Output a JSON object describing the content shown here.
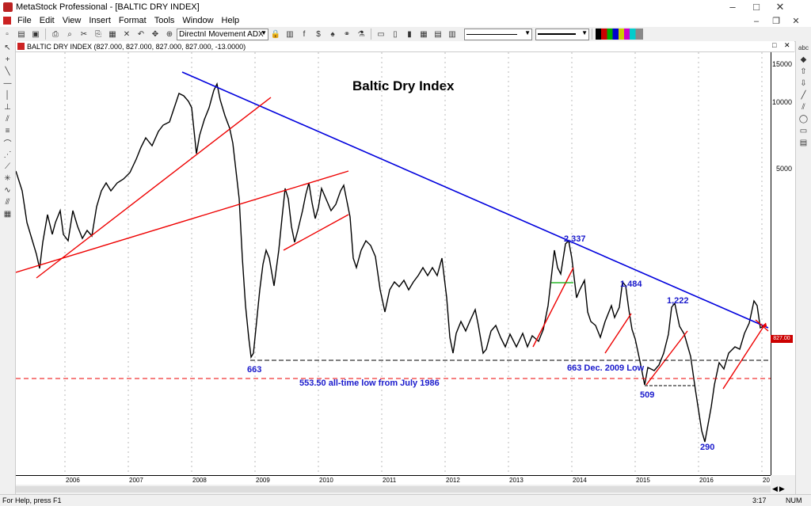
{
  "window": {
    "title": "MetaStock Professional - [BALTIC DRY INDEX]"
  },
  "menu": [
    "File",
    "Edit",
    "View",
    "Insert",
    "Format",
    "Tools",
    "Window",
    "Help"
  ],
  "toolbar": {
    "indicator_combo": "DirectnI Movement ADX"
  },
  "chart_window": {
    "title": "BALTIC DRY INDEX (827.000, 827.000, 827.000, 827.000, -13.0000)"
  },
  "chart_data": {
    "type": "line",
    "title": "Baltic Dry Index",
    "y_scale": "log",
    "yticks": [
      "15000",
      "10000",
      "5000"
    ],
    "xticks": [
      "2006",
      "2007",
      "2008",
      "2009",
      "2010",
      "2011",
      "2012",
      "2013",
      "2014",
      "2015",
      "2016",
      "20"
    ],
    "annotations": [
      "663",
      "663 Dec. 2009 Low",
      "553.50 all-time low from July 1986",
      "2,337",
      "1,484",
      "1,222",
      "509",
      "290"
    ],
    "last_value": "827.00",
    "colors": {
      "price": "#000000",
      "trend": "#0000dd",
      "support": "#ee0000",
      "annotation": "#1a1acc"
    }
  },
  "status": {
    "help": "For Help, press F1",
    "time": "3:17",
    "num": "NUM"
  }
}
